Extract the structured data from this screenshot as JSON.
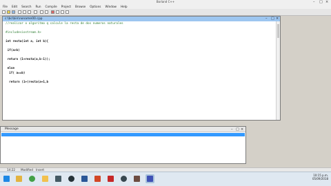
{
  "window": {
    "title": "Borland C++"
  },
  "menu": [
    "File",
    "Edit",
    "Search",
    "Run",
    "Compile",
    "Project",
    "Browse",
    "Options",
    "Window",
    "Help"
  ],
  "editor": {
    "title": "c:\\bc\\bin\\noname00.cpp",
    "lines": [
      "//realizar o algoritmo q calcule la resta de dos numeros naturales",
      "",
      "#include<iostream.h>",
      "",
      "int resta(int a, int b){",
      "",
      " if(a>b)",
      "",
      " return (1+resta(a,b-1));",
      "",
      " else",
      "  if( a==b)",
      "",
      "  return (1+(resta(a+1,b",
      "",
      ""
    ]
  },
  "message_window": {
    "title": "Message"
  },
  "status": {
    "position": "14:22",
    "mode": "Modified",
    "insert": "Insert"
  },
  "clock": {
    "time": "10:15 p.m.",
    "date": "05/09/2018"
  },
  "taskbar": {
    "icons": [
      "windows-start-icon",
      "file-explorer-icon",
      "chrome-icon",
      "folder-icon",
      "media-icon",
      "steam-icon",
      "word-icon",
      "powerpoint-icon",
      "acrobat-icon",
      "other-app-icon",
      "chess-icon",
      "borland-icon"
    ]
  },
  "colors": {
    "editor_caption": "#9dc6f0",
    "selection": "#3399ff",
    "taskbar": "#dfe8f1"
  }
}
